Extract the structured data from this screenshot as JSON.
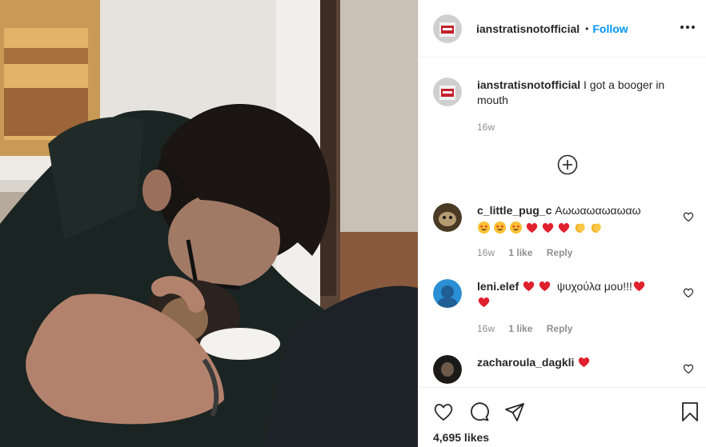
{
  "post": {
    "author": "ianstratisnotofficial",
    "follow_label": "Follow",
    "separator": "•",
    "caption": {
      "username": "ianstratisnotofficial",
      "text": "I got a booger in mouth",
      "time": "16w"
    },
    "comments": [
      {
        "username": "c_little_pug_c",
        "text": "Αωωαωαωαωαω",
        "emojis": [
          "star-struck",
          "star-struck",
          "star-struck",
          "red-heart",
          "red-heart",
          "red-heart",
          "clapping-hands",
          "clapping-hands"
        ],
        "time": "16w",
        "likes": "1 like",
        "reply": "Reply"
      },
      {
        "username": "leni.elef",
        "text": "ψυχούλα μου!!!",
        "emojis_before": [
          "red-heart",
          "red-heart"
        ],
        "emojis_after": [
          "red-heart",
          "red-heart"
        ],
        "time": "16w",
        "likes": "1 like",
        "reply": "Reply"
      },
      {
        "username": "zacharoula_dagkli",
        "emojis": [
          "red-heart"
        ]
      }
    ],
    "likes_count": "4,695 likes",
    "icons": [
      "more-options-icon",
      "add-comment-icon",
      "heart-icon",
      "comment-icon",
      "share-icon",
      "bookmark-icon"
    ],
    "accent_color": "#0095f6",
    "text_color": "#262626",
    "muted_color": "#8e8e8e"
  }
}
